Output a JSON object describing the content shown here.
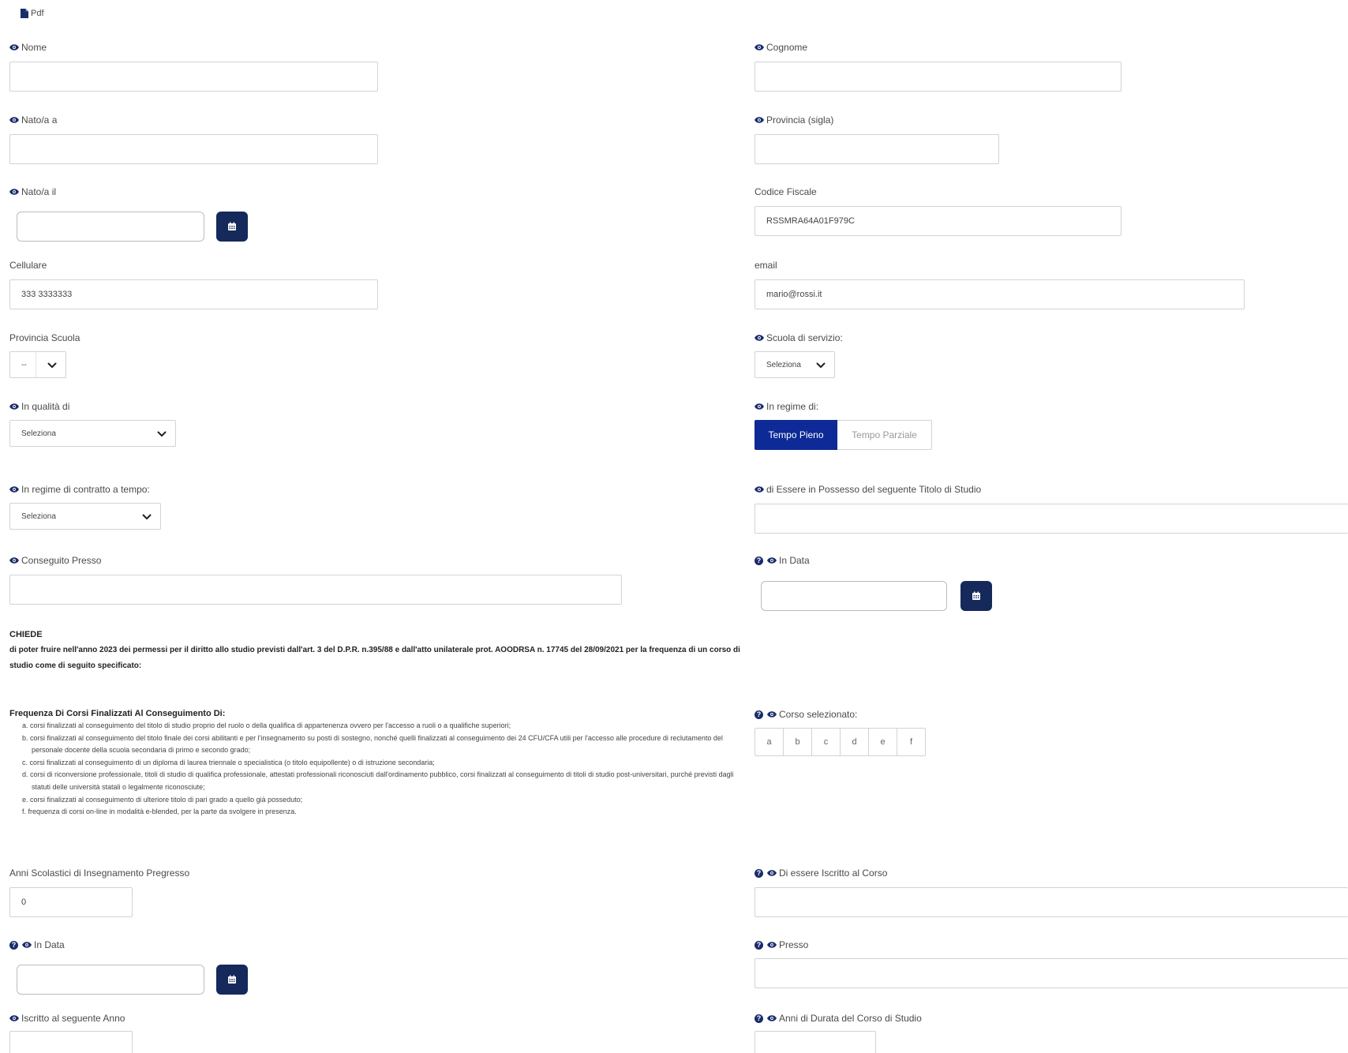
{
  "toolbar": {
    "pdf_label": "Pdf"
  },
  "fields": {
    "nome": {
      "label": "Nome",
      "value": ""
    },
    "cognome": {
      "label": "Cognome",
      "value": ""
    },
    "nato_a": {
      "label": "Nato/a a",
      "value": ""
    },
    "provincia_sigla": {
      "label": "Provincia (sigla)",
      "value": ""
    },
    "nato_il": {
      "label": "Nato/a il",
      "value": ""
    },
    "codice_fiscale": {
      "label": "Codice Fiscale",
      "value": "RSSMRA64A01F979C"
    },
    "cellulare": {
      "label": "Cellulare",
      "value": "333 3333333"
    },
    "email": {
      "label": "email",
      "value": "mario@rossi.it"
    },
    "provincia_scuola": {
      "label": "Provincia Scuola",
      "value": "--"
    },
    "scuola_servizio": {
      "label": "Scuola di servizio:",
      "value": "Seleziona"
    },
    "qualita": {
      "label": "In qualità di",
      "value": "Seleziona"
    },
    "regime": {
      "label": "In regime di:",
      "options": [
        "Tempo Pieno",
        "Tempo Parziale"
      ],
      "selected": "Tempo Pieno"
    },
    "contratto": {
      "label": "In regime di contratto a tempo:",
      "value": "Seleziona"
    },
    "titolo_studio": {
      "label": "di Essere in Possesso del seguente Titolo di Studio",
      "value": ""
    },
    "conseguito_presso": {
      "label": "Conseguito Presso",
      "value": ""
    },
    "in_data_1": {
      "label": "In Data",
      "value": ""
    },
    "corso_selezionato": {
      "label": "Corso selezionato:",
      "options": [
        "a",
        "b",
        "c",
        "d",
        "e",
        "f"
      ]
    },
    "anni_pregresso": {
      "label": "Anni Scolastici di Insegnamento Pregresso",
      "value": "0"
    },
    "iscritto_corso": {
      "label": "Di essere Iscritto al Corso",
      "value": ""
    },
    "in_data_2": {
      "label": "In Data",
      "value": ""
    },
    "presso": {
      "label": "Presso",
      "value": ""
    },
    "iscritto_anno": {
      "label": "Iscritto al seguente Anno",
      "value": ""
    },
    "anni_durata": {
      "label": "Anni di Durata del Corso di Studio",
      "value": ""
    }
  },
  "chiede": {
    "title": "CHIEDE",
    "text": "di poter fruire nell'anno 2023 dei permessi per il diritto allo studio previsti dall'art. 3 del D.P.R. n.395/88 e dall'atto unilaterale prot. AOODRSA n. 17745 del 28/09/2021 per la frequenza di un corso di studio come di seguito specificato:"
  },
  "frequenza": {
    "title": "Frequenza Di Corsi Finalizzati Al Conseguimento Di:",
    "items": [
      "a. corsi finalizzati al conseguimento del titolo di studio proprio del ruolo o della qualifica di appartenenza ovvero per l'accesso a ruoli o a qualifiche superiori;",
      "b. corsi finalizzati al conseguimento del titolo finale dei corsi abilitanti e per l'insegnamento su posti di sostegno, nonché quelli finalizzati al conseguimento dei 24 CFU/CFA utili per l'accesso alle procedure di reclutamento del personale docente della scuola secondaria di primo e secondo grado;",
      "c. corsi finalizzati al conseguimento di un diploma di laurea triennale o specialistica (o titolo equipollente) o di istruzione secondaria;",
      "d. corsi di riconversione professionale, titoli di studio di qualifica professionale, attestati professionali riconosciuti dall'ordinamento pubblico, corsi finalizzati al conseguimento di titoli di studio post-universitari, purché previsti dagli statuti delle università statali o legalmente riconosciute;",
      "e. corsi finalizzati al conseguimento di ulteriore titolo di pari grado a quello già posseduto;",
      "f. frequenza di corsi on-line in modalità e-blended, per la parte da svolgere in presenza."
    ]
  },
  "colors": {
    "primary": "#15295b",
    "segment_active": "#0d2a96",
    "border": "#cfd3d8"
  }
}
